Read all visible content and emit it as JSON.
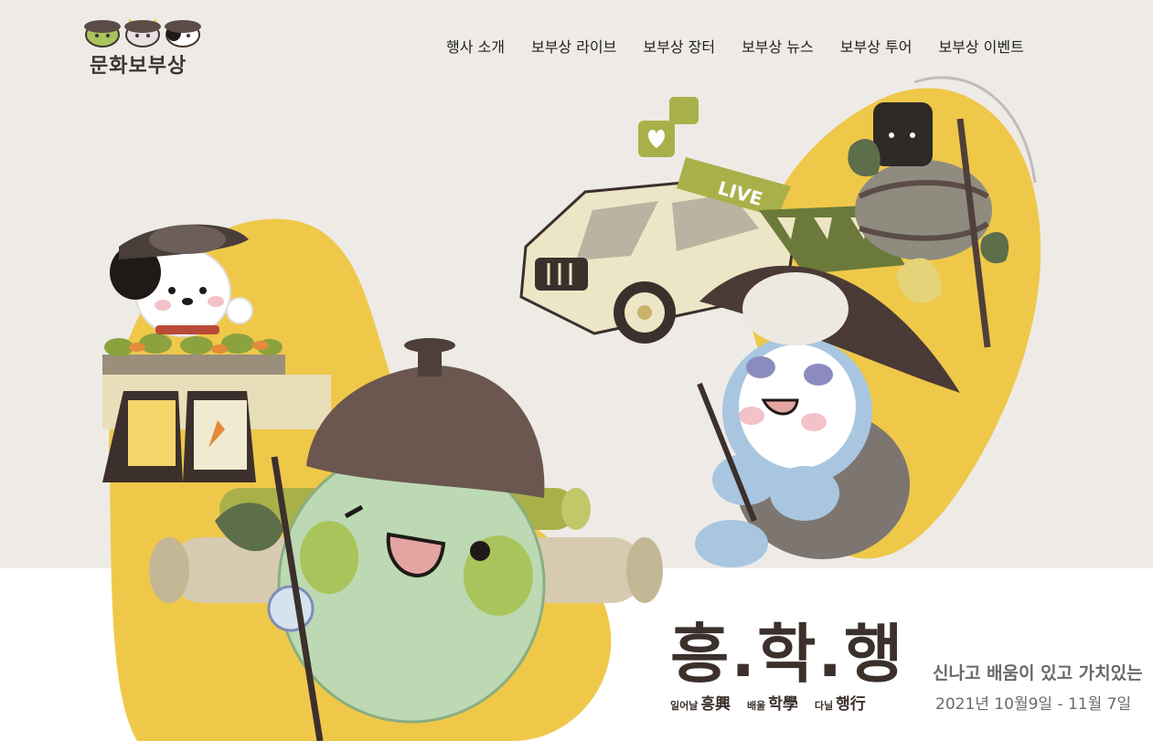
{
  "logo": {
    "text": "문화보부상"
  },
  "nav": {
    "items": [
      {
        "label": "행사 소개"
      },
      {
        "label": "보부상 라이브"
      },
      {
        "label": "보부상 장터"
      },
      {
        "label": "보부상 뉴스"
      },
      {
        "label": "보부상 투어"
      },
      {
        "label": "보부상 이벤트"
      }
    ]
  },
  "hero": {
    "title": "흥.학.행",
    "subtitles": [
      {
        "small": "일어날",
        "big": "흥興"
      },
      {
        "small": "배울",
        "big": "학學"
      },
      {
        "small": "다닐",
        "big": "행行"
      }
    ],
    "tagline": "신나고 배움이 있고 가치있는",
    "date": "2021년 10월9일 - 11월 7일",
    "live_sign": "LIVE"
  },
  "colors": {
    "top_background": "#eeebe7",
    "blob_yellow": "#efc84a",
    "brand_dark": "#3b302c",
    "green_mascot": "#bcd9b3",
    "blue_mascot": "#a9c6e0",
    "truck": "#ede6c6",
    "olive": "#a9b04a"
  }
}
